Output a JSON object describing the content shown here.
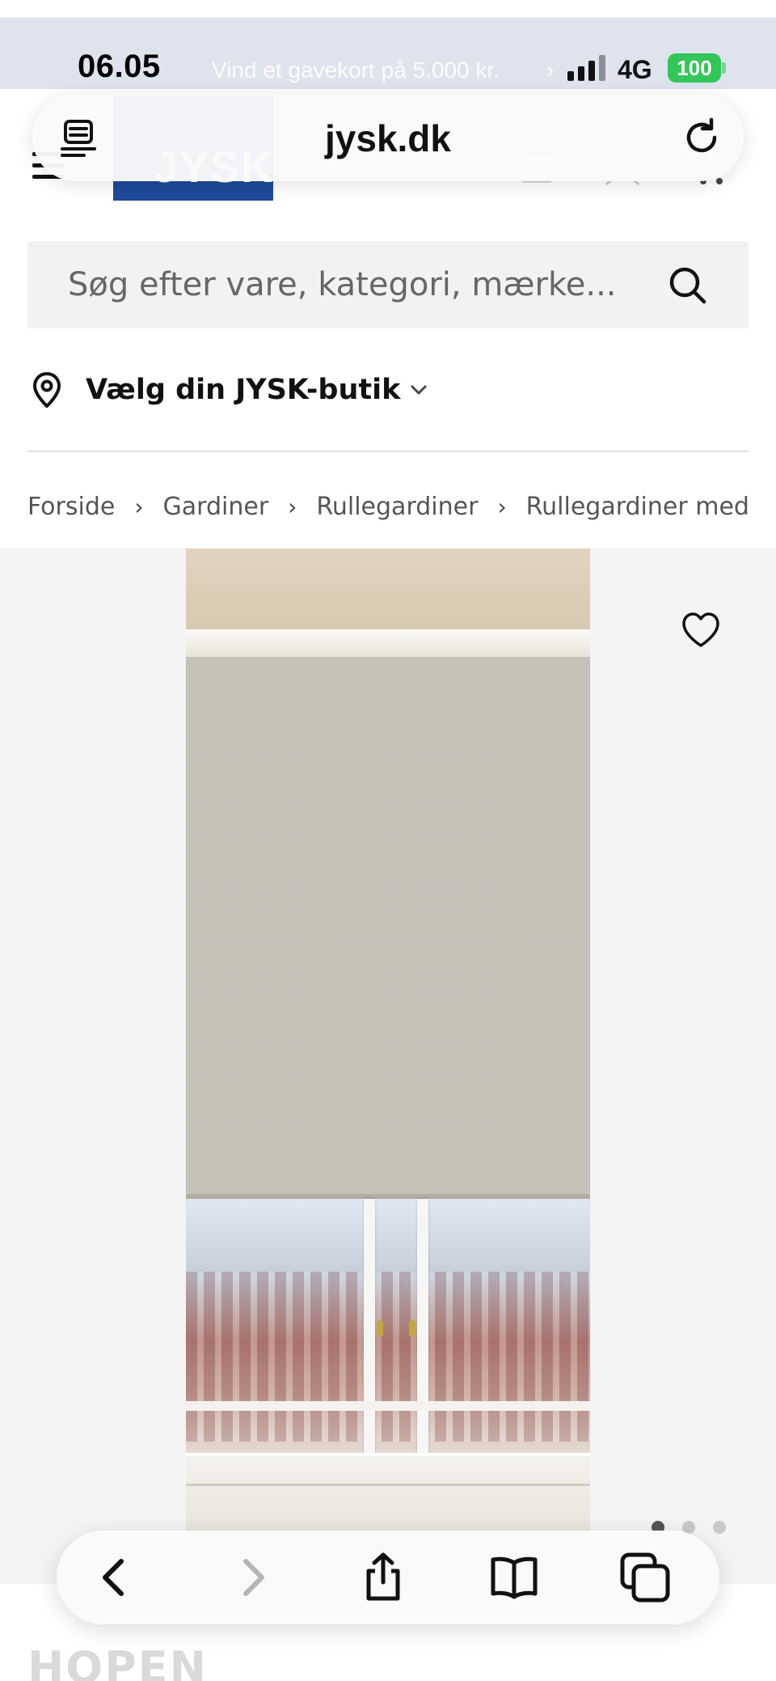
{
  "status_bar": {
    "time": "06.05",
    "marquee": "Vind et gavekort på 5.000 kr.",
    "network": "4G",
    "battery": "100",
    "signal_bars_filled": 3,
    "signal_bars_total": 4
  },
  "browser": {
    "url": "jysk.dk"
  },
  "site": {
    "logo_text": "JYSK",
    "brand_color": "#1f4a9a"
  },
  "search": {
    "placeholder": "Søg efter vare, kategori, mærke..."
  },
  "store": {
    "label": "Vælg din JYSK-butik"
  },
  "breadcrumb": [
    "Forside",
    "Gardiner",
    "Rullegardiner",
    "Rullegardiner med mø"
  ],
  "breadcrumb_separator": "›",
  "gallery": {
    "image_count": 3,
    "active_index": 0
  },
  "product": {
    "title_peek": "HOPEN"
  },
  "toolbar": {
    "icons": [
      "back-icon",
      "forward-icon",
      "share-icon",
      "bookmarks-icon",
      "tabs-icon"
    ]
  }
}
